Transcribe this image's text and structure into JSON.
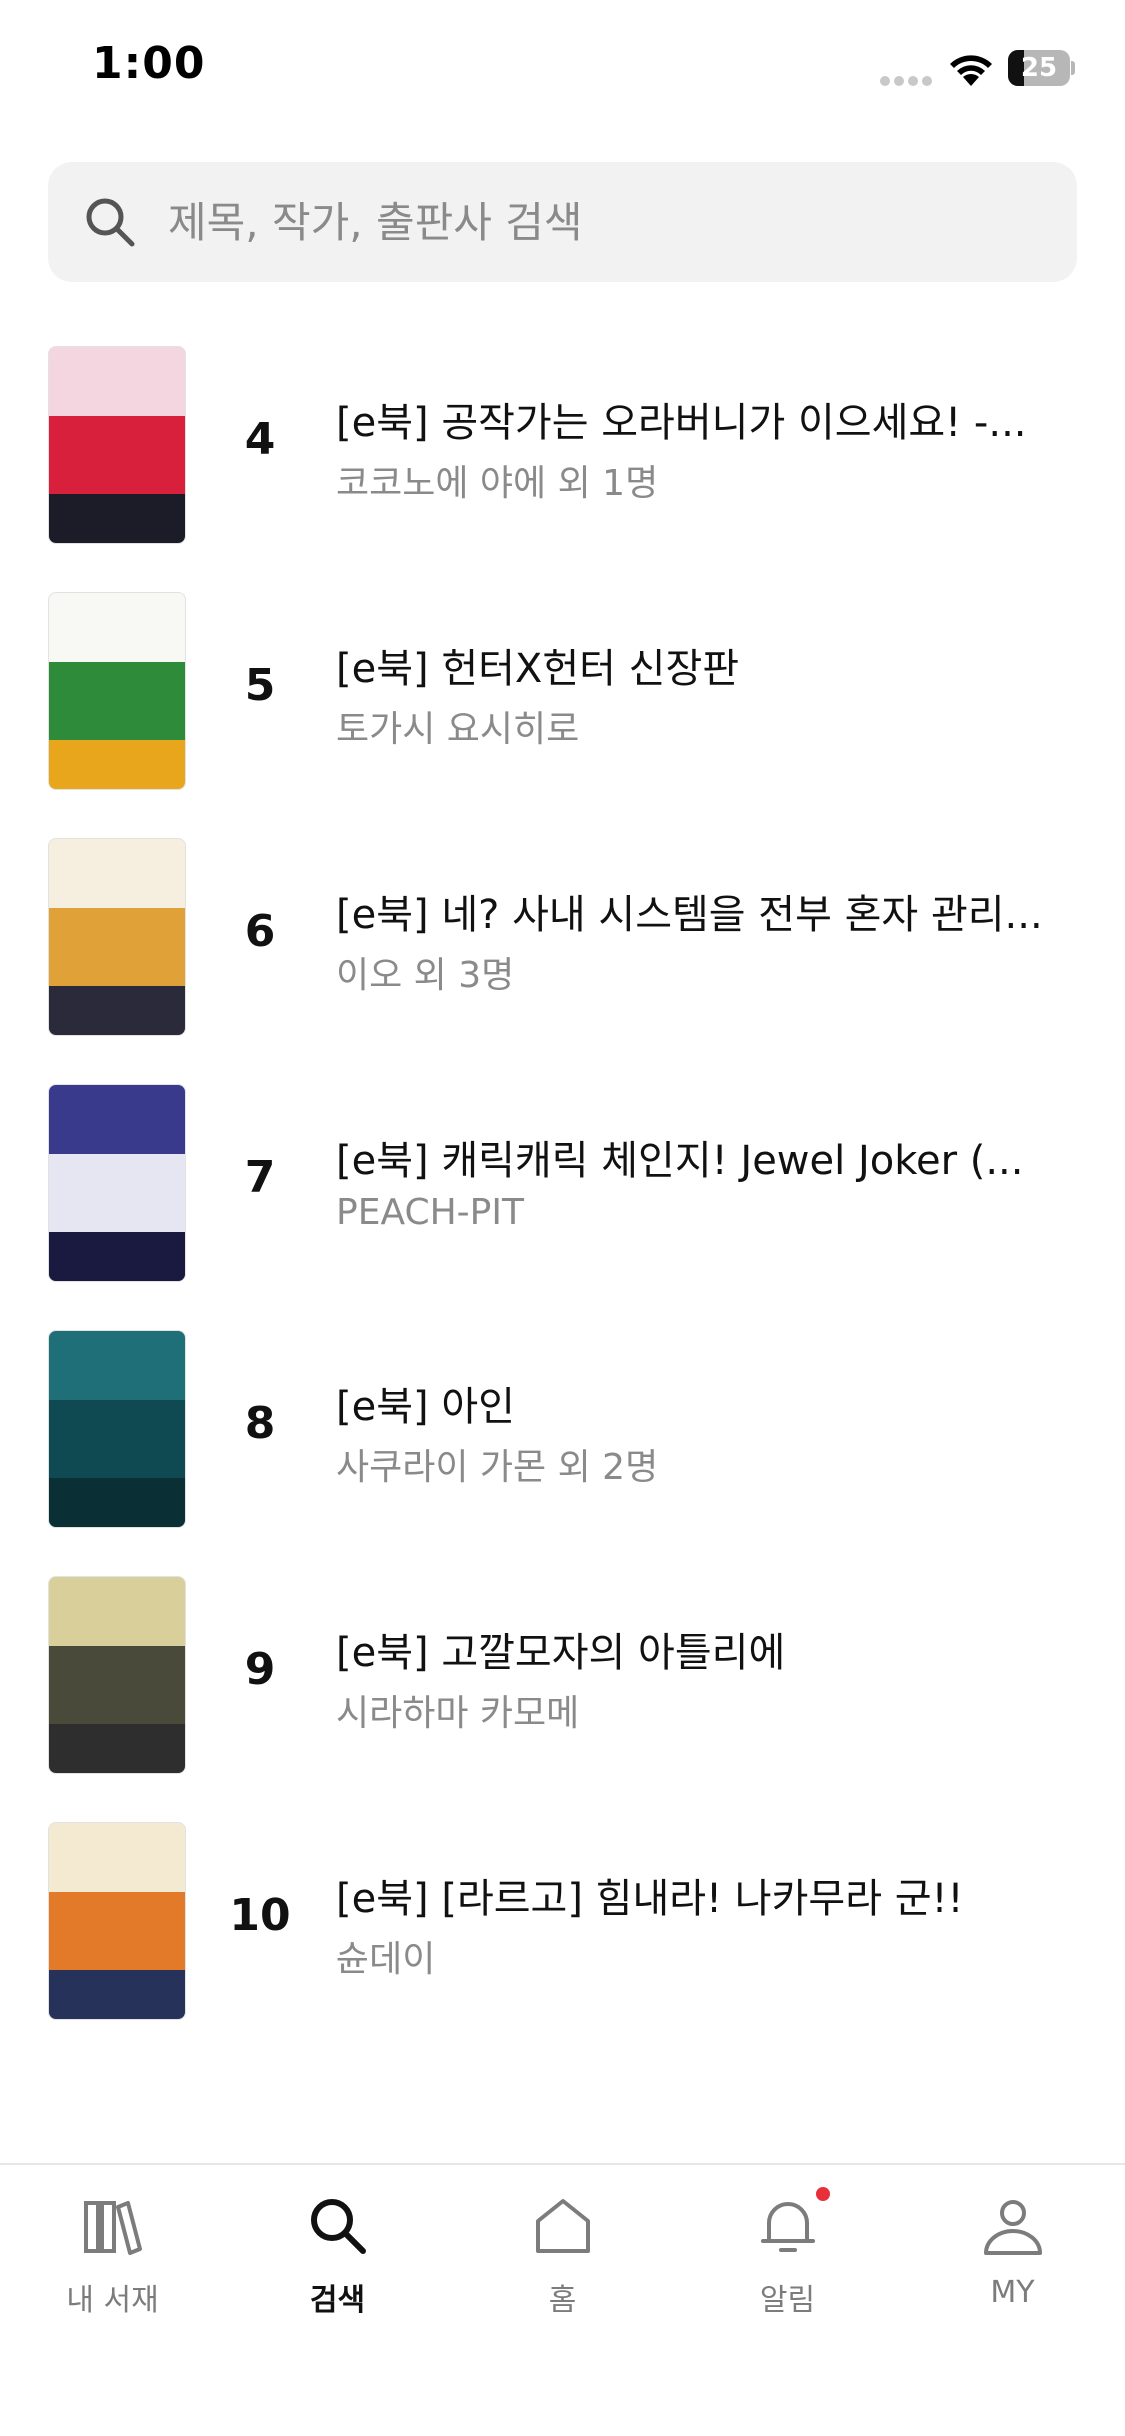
{
  "status_bar": {
    "time": "1:00",
    "battery": "25",
    "battery_level": 0.25
  },
  "search": {
    "placeholder": "제목, 작가, 출판사 검색",
    "value": ""
  },
  "list": [
    {
      "rank": "4",
      "title": "[e북] 공작가는 오라버니가 이으세요! -...",
      "author": "코코노에 야에 외 1명",
      "cover_colors": [
        "#f4d6e0",
        "#d8203c",
        "#1c1c28"
      ]
    },
    {
      "rank": "5",
      "title": "[e북] 헌터X헌터 신장판",
      "author": "토가시 요시히로",
      "cover_colors": [
        "#f8f8f4",
        "#2e8b3a",
        "#e8a61c"
      ]
    },
    {
      "rank": "6",
      "title": "[e북] 네? 사내 시스템을 전부 혼자 관리...",
      "author": "이오 외 3명",
      "cover_colors": [
        "#f6efe0",
        "#e0a238",
        "#2a2a3a"
      ]
    },
    {
      "rank": "7",
      "title": "[e북] 캐릭캐릭 체인지! Jewel Joker (...",
      "author": "PEACH-PIT",
      "cover_colors": [
        "#3a3a8c",
        "#e6e6f2",
        "#1a1a40"
      ]
    },
    {
      "rank": "8",
      "title": "[e북] 아인",
      "author": "사쿠라이 가몬 외 2명",
      "cover_colors": [
        "#1f6f78",
        "#0f4a52",
        "#0a3036"
      ]
    },
    {
      "rank": "9",
      "title": "[e북] 고깔모자의 아틀리에",
      "author": "시라하마 카모메",
      "cover_colors": [
        "#d9cf9a",
        "#4a4a3a",
        "#2e2e2e"
      ]
    },
    {
      "rank": "10",
      "title": "[e북] [라르고] 힘내라! 나카무라 군!!",
      "author": "슌데이",
      "cover_colors": [
        "#f4ead2",
        "#e27a2a",
        "#26325a"
      ]
    }
  ],
  "tab_bar": {
    "tabs": [
      {
        "label": "내 서재",
        "icon": "library-icon"
      },
      {
        "label": "검색",
        "icon": "search-icon"
      },
      {
        "label": "홈",
        "icon": "home-icon"
      },
      {
        "label": "알림",
        "icon": "bell-icon"
      },
      {
        "label": "MY",
        "icon": "profile-icon"
      }
    ],
    "active": "검색",
    "notification_dot_color": "#e8303a"
  }
}
